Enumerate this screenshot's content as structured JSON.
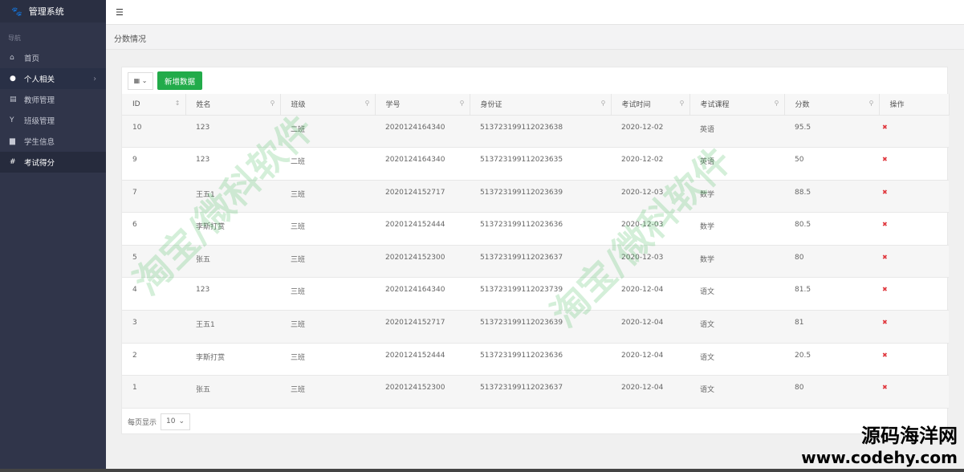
{
  "sidebar": {
    "brand": "管理系统",
    "nav_label": "导航",
    "items": [
      {
        "label": "首页",
        "icon": "home-icon"
      },
      {
        "label": "个人相关",
        "icon": "user-icon"
      },
      {
        "label": "教师管理",
        "icon": "list-icon"
      },
      {
        "label": "班级管理",
        "icon": "trophy-icon"
      },
      {
        "label": "学生信息",
        "icon": "group-icon"
      },
      {
        "label": "考试得分",
        "icon": "hash-icon"
      }
    ]
  },
  "topbar": {
    "menu_icon": "menu-toggle-icon"
  },
  "breadcrumb": "分数情况",
  "toolbar": {
    "add_label": "新增数据"
  },
  "table": {
    "columns": [
      "ID",
      "姓名",
      "班级",
      "学号",
      "身份证",
      "考试时间",
      "考试课程",
      "分数",
      "操作"
    ],
    "rows": [
      [
        "10",
        "123",
        "二班",
        "2020124164340",
        "513723199112023638",
        "2020-12-02",
        "英语",
        "95.5"
      ],
      [
        "9",
        "123",
        "二班",
        "2020124164340",
        "513723199112023635",
        "2020-12-02",
        "英语",
        "50"
      ],
      [
        "7",
        "王五1",
        "三班",
        "2020124152717",
        "513723199112023639",
        "2020-12-03",
        "数学",
        "88.5"
      ],
      [
        "6",
        "李斯打赏",
        "三班",
        "2020124152444",
        "513723199112023636",
        "2020-12-03",
        "数学",
        "80.5"
      ],
      [
        "5",
        "张五",
        "三班",
        "2020124152300",
        "513723199112023637",
        "2020-12-03",
        "数学",
        "80"
      ],
      [
        "4",
        "123",
        "三班",
        "2020124164340",
        "513723199112023739",
        "2020-12-04",
        "语文",
        "81.5"
      ],
      [
        "3",
        "王五1",
        "三班",
        "2020124152717",
        "513723199112023639",
        "2020-12-04",
        "语文",
        "81"
      ],
      [
        "2",
        "李斯打赏",
        "三班",
        "2020124152444",
        "513723199112023636",
        "2020-12-04",
        "语文",
        "20.5"
      ],
      [
        "1",
        "张五",
        "三班",
        "2020124152300",
        "513723199112023637",
        "2020-12-04",
        "语文",
        "80"
      ]
    ],
    "delete_glyph": "✖"
  },
  "footer": {
    "per_page_label": "每页显示",
    "per_page": "10"
  },
  "watermark": {
    "text": "淘宝/微科软件",
    "site_name": "源码海洋网",
    "site_url": "www.codehy.com"
  }
}
